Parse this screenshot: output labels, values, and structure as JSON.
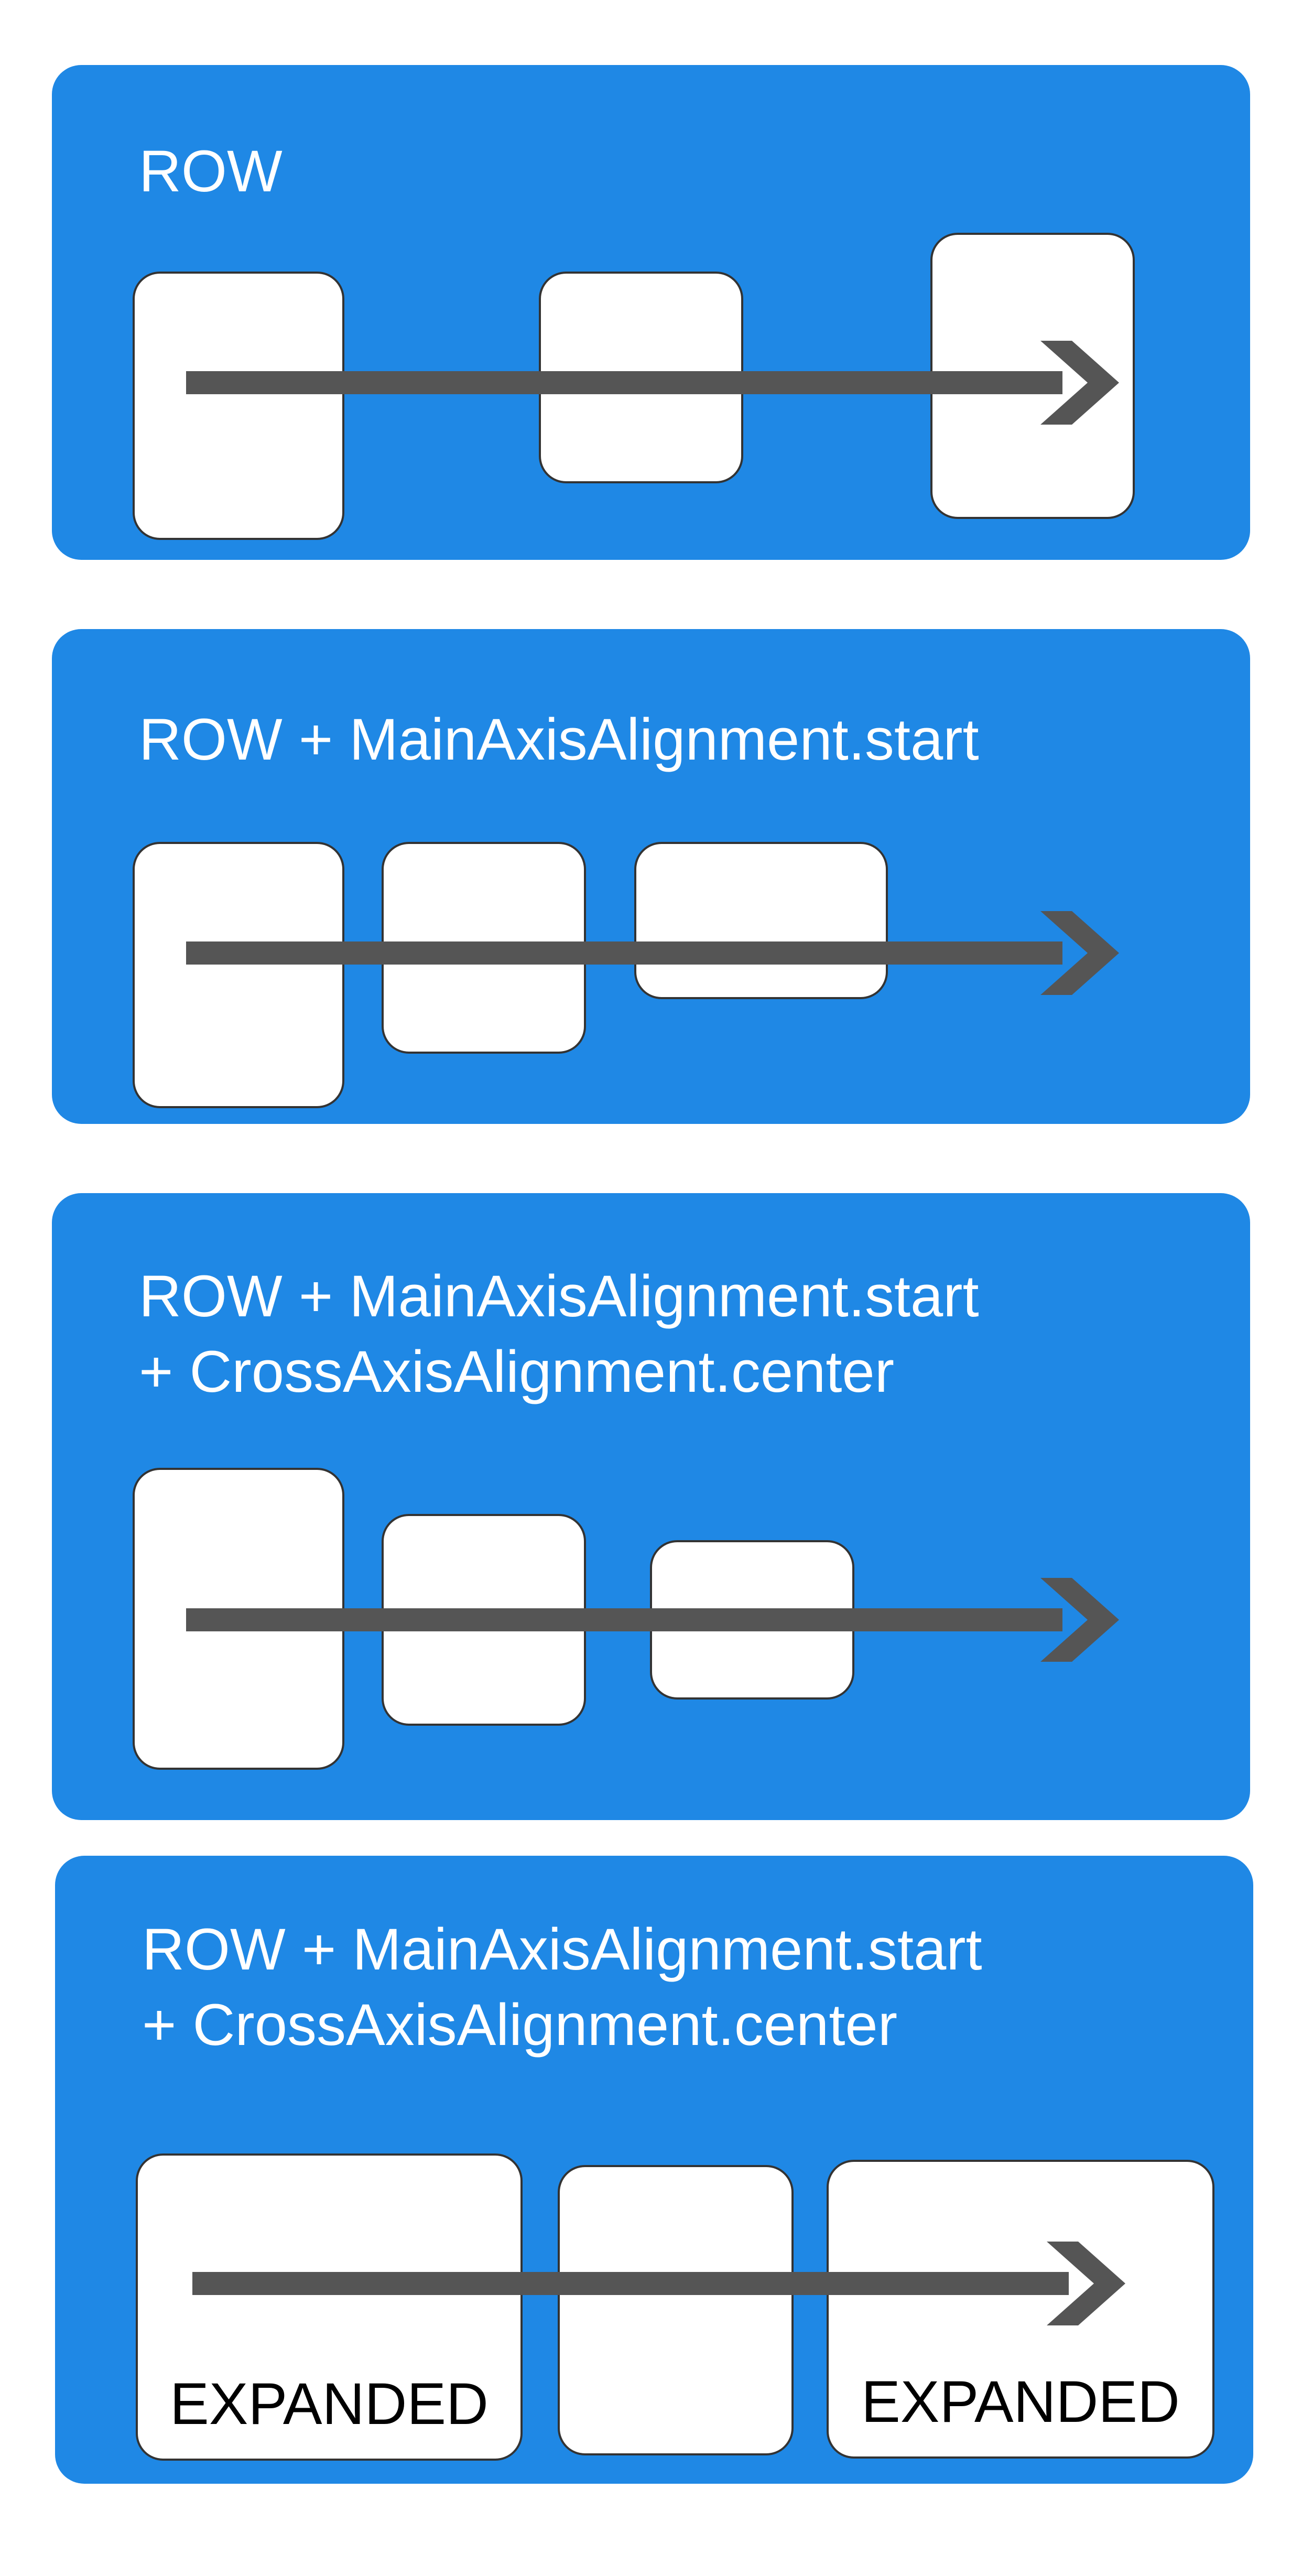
{
  "colors": {
    "panel_background": "#1f88e5",
    "box_fill": "#ffffff",
    "box_border": "#333333",
    "arrow": "#555555",
    "title_text": "#ffffff",
    "label_text": "#000000"
  },
  "icons": {
    "axis_arrow": "arrow-right-icon"
  },
  "panels": [
    {
      "title_lines": [
        "ROW"
      ]
    },
    {
      "title_lines": [
        "ROW + MainAxisAlignment.start"
      ]
    },
    {
      "title_lines": [
        "ROW + MainAxisAlignment.start",
        "+ CrossAxisAlignment.center"
      ]
    },
    {
      "title_lines": [
        "ROW + MainAxisAlignment.start",
        "+ CrossAxisAlignment.center"
      ],
      "box_labels": [
        "EXPANDED",
        "",
        "EXPANDED"
      ]
    }
  ]
}
